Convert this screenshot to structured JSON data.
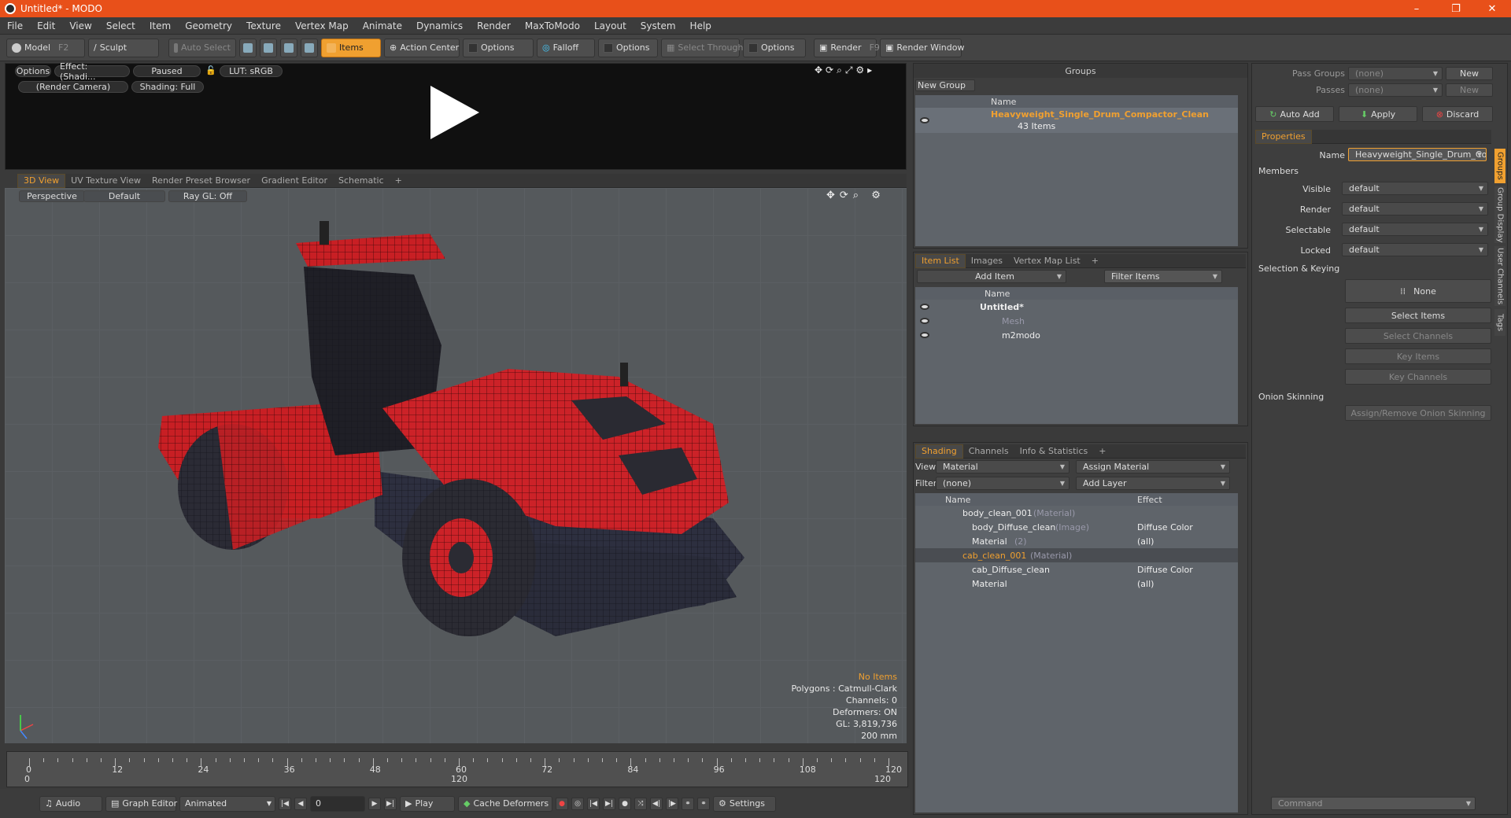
{
  "window": {
    "title": "Untitled* - MODO",
    "min": "–",
    "max": "❐",
    "close": "✕"
  },
  "menu": [
    "File",
    "Edit",
    "View",
    "Select",
    "Item",
    "Geometry",
    "Texture",
    "Vertex Map",
    "Animate",
    "Dynamics",
    "Render",
    "MaxToModo",
    "Layout",
    "System",
    "Help"
  ],
  "toolbar": {
    "model": "Model",
    "model_key": "F2",
    "sculpt": "Sculpt",
    "auto_select": "Auto Select",
    "items": "Items",
    "action_center": "Action Center",
    "options1": "Options",
    "falloff": "Falloff",
    "options2": "Options",
    "select_through": "Select Through",
    "options3": "Options",
    "render": "Render",
    "render_key": "F9",
    "render_window": "Render Window"
  },
  "preview": {
    "options": "Options",
    "effect": "Effect: (Shadi...",
    "paused": "Paused",
    "lut": "LUT: sRGB",
    "camera": "(Render Camera)",
    "shading": "Shading: Full"
  },
  "view_tabs": [
    "3D View",
    "UV Texture View",
    "Render Preset Browser",
    "Gradient Editor",
    "Schematic",
    "+"
  ],
  "viewport": {
    "perspective": "Perspective",
    "default": "Default",
    "raygl": "Ray GL: Off",
    "info": {
      "no_items": "No Items",
      "polygons": "Polygons : Catmull-Clark",
      "channels": "Channels: 0",
      "deformers": "Deformers: ON",
      "gl": "GL: 3,819,736",
      "scale": "200 mm"
    }
  },
  "timeline": {
    "ticks": [
      "0",
      "12",
      "24",
      "36",
      "48",
      "60",
      "72",
      "84",
      "96",
      "108",
      "120"
    ],
    "sub": [
      "0",
      "120",
      "120"
    ]
  },
  "transport": {
    "audio": "Audio",
    "graph_editor": "Graph Editor",
    "animated": "Animated",
    "frame": "0",
    "play": "Play",
    "cache": "Cache Deformers",
    "settings": "Settings"
  },
  "groups": {
    "title": "Groups",
    "new_group": "New Group",
    "col_name": "Name",
    "item_name": "Heavyweight_Single_Drum_Compactor_Clean",
    "item_count": "43 Items"
  },
  "item_list": {
    "tabs": [
      "Item List",
      "Images",
      "Vertex Map List",
      "+"
    ],
    "add_item": "Add Item",
    "filter": "Filter Items",
    "col_name": "Name",
    "rows": [
      "Untitled*",
      "Mesh",
      "m2modo"
    ]
  },
  "shading": {
    "tabs": [
      "Shading",
      "Channels",
      "Info & Statistics",
      "+"
    ],
    "view_label": "View",
    "view_value": "Material",
    "assign": "Assign Material",
    "filter_label": "Filter",
    "filter_value": "(none)",
    "add_layer": "Add Layer",
    "col_name": "Name",
    "col_effect": "Effect",
    "rows": [
      {
        "name": "body_clean_001",
        "tag": "(Material)",
        "effect": ""
      },
      {
        "name": "body_Diffuse_clean",
        "tag": "(Image)",
        "effect": "Diffuse Color"
      },
      {
        "name": "Material",
        "tag": "(2)",
        "effect": "(all)"
      },
      {
        "name": "cab_clean_001",
        "tag": "(Material)",
        "effect": ""
      },
      {
        "name": "cab_Diffuse_clean",
        "tag": "(Image)",
        "effect": "Diffuse Color"
      },
      {
        "name": "Material",
        "tag": "",
        "effect": "(all)"
      }
    ]
  },
  "props": {
    "pass_groups": "Pass Groups",
    "pass_groups_val": "(none)",
    "new": "New",
    "passes": "Passes",
    "passes_val": "(none)",
    "new2": "New",
    "auto_add": "Auto Add",
    "apply": "Apply",
    "discard": "Discard",
    "tab": "Properties",
    "name_label": "Name",
    "name_value": "Heavyweight_Single_Drum_Compac",
    "members": "Members",
    "visible": "Visible",
    "render": "Render",
    "selectable": "Selectable",
    "locked": "Locked",
    "default": "default",
    "sel_keying": "Selection & Keying",
    "none": "None",
    "select_items": "Select Items",
    "select_channels": "Select Channels",
    "key_items": "Key Items",
    "key_channels": "Key Channels",
    "onion": "Onion Skinning",
    "assign_onion": "Assign/Remove Onion Skinning",
    "vtabs": [
      "Groups",
      "Group Display",
      "User Channels",
      "Tags"
    ],
    "command": "Command"
  },
  "colors": {
    "accent": "#f0a030",
    "titlebar": "#e8501a"
  }
}
